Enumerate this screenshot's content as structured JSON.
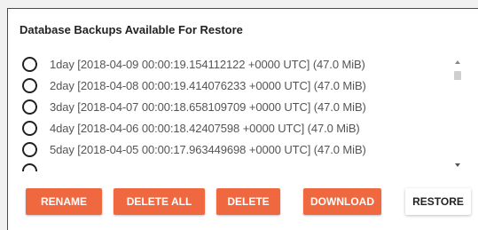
{
  "section": {
    "title": "Database Backups Available For Restore"
  },
  "backups": [
    {
      "label": "1day [2018-04-09 00:00:19.154112122 +0000 UTC] (47.0 MiB)"
    },
    {
      "label": "2day [2018-04-08 00:00:19.414076233 +0000 UTC] (47.0 MiB)"
    },
    {
      "label": "3day [2018-04-07 00:00:18.658109709 +0000 UTC] (47.0 MiB)"
    },
    {
      "label": "4day [2018-04-06 00:00:18.42407598 +0000 UTC] (47.0 MiB)"
    },
    {
      "label": "5day [2018-04-05 00:00:17.963449698 +0000 UTC] (47.0 MiB)"
    }
  ],
  "actions": {
    "rename": "RENAME",
    "delete_all": "DELETE ALL",
    "delete": "DELETE",
    "download": "DOWNLOAD",
    "restore": "RESTORE"
  },
  "colors": {
    "accent": "#f0683f"
  }
}
